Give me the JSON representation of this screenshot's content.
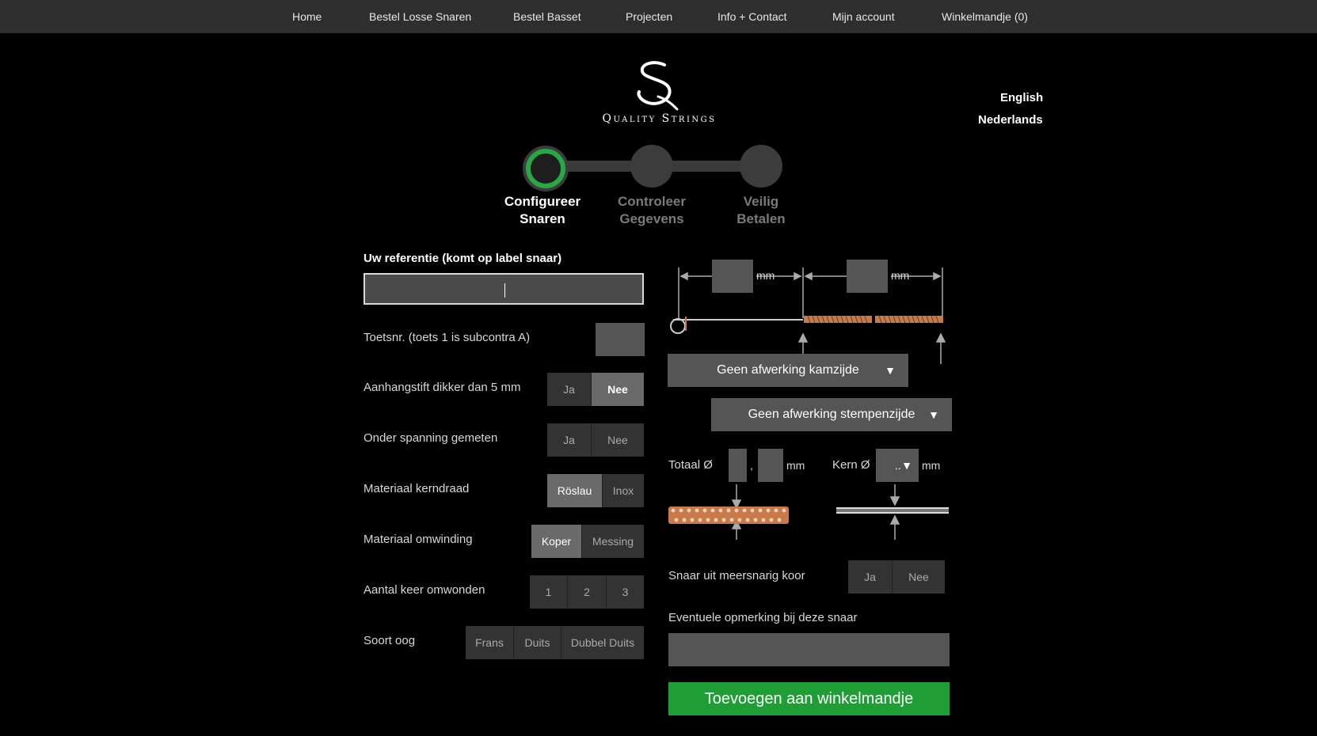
{
  "nav": {
    "items": [
      "Home",
      "Bestel Losse Snaren",
      "Bestel Basset",
      "Projecten",
      "Info + Contact",
      "Mijn account",
      "Winkelmandje (0)"
    ]
  },
  "brand": {
    "logo_text": "Quality Strings"
  },
  "languages": [
    "English",
    "Nederlands"
  ],
  "steps": [
    {
      "line1": "Configureer",
      "line2": "Snaren",
      "active": true
    },
    {
      "line1": "Controleer",
      "line2": "Gegevens",
      "active": false
    },
    {
      "line1": "Veilig",
      "line2": "Betalen",
      "active": false
    }
  ],
  "form": {
    "reference_label": "Uw referentie (komt op label snaar)",
    "reference_value": "",
    "key_label": "Toetsnr. (toets 1 is subcontra A)",
    "pin_label": "Aanhangstift dikker dan 5 mm",
    "pin_options": [
      "Ja",
      "Nee"
    ],
    "pin_selected": "Nee",
    "tension_label": "Onder spanning gemeten",
    "tension_options": [
      "Ja",
      "Nee"
    ],
    "core_label": "Materiaal kerndraad",
    "core_options": [
      "Röslau",
      "Inox"
    ],
    "core_selected": "Röslau",
    "winding_label": "Materiaal omwinding",
    "winding_options": [
      "Koper",
      "Messing"
    ],
    "winding_selected": "Koper",
    "count_label": "Aantal keer omwonden",
    "count_options": [
      "1",
      "2",
      "3"
    ],
    "eye_label": "Soort oog",
    "eye_options": [
      "Frans",
      "Duits",
      "Dubbel Duits"
    ]
  },
  "diagram": {
    "unit": "mm",
    "finish_comb": "Geen afwerking kamzijde",
    "finish_pin": "Geen afwerking stempenzijde",
    "total_label": "Totaal Ø",
    "decimal_sep": ",",
    "core_label": "Kern Ø",
    "core_select_value": ".."
  },
  "extra": {
    "multistrand_label": "Snaar uit meersnarig koor",
    "multistrand_options": [
      "Ja",
      "Nee"
    ],
    "remark_label": "Eventuele opmerking bij deze snaar",
    "add_to_cart": "Toevoegen aan winkelmandje"
  },
  "colors": {
    "accent_green": "#1e9e34",
    "step_active": "#28a745",
    "copper": "#c87a4a"
  }
}
